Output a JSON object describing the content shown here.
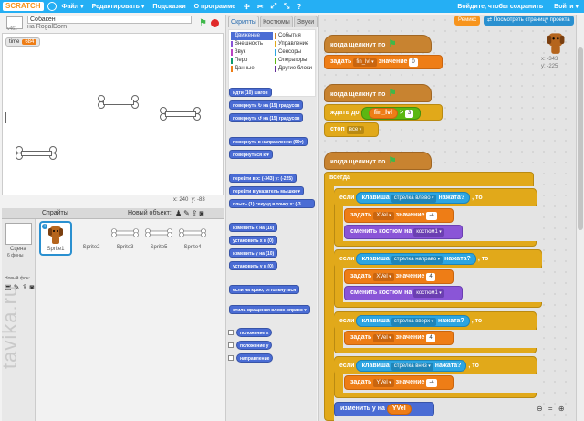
{
  "topbar": {
    "logo": "SCRATCH",
    "menu": [
      "Файл ▾",
      "Редактировать ▾",
      "Подсказки",
      "О программе"
    ],
    "right_save": "Войдите, чтобы сохранить",
    "right_login": "Войти ▾"
  },
  "project": {
    "title": "Собакен",
    "author": "на RogalDorn",
    "version": "v461"
  },
  "stage": {
    "monitor_label": "time",
    "monitor_value": "684",
    "coords_x": "x: 240",
    "coords_y": "y: -83"
  },
  "sprites_panel": {
    "label": "Спрайты",
    "new_object": "Новый объект:",
    "stage_label": "Сцена",
    "stage_sub": "6 фоны",
    "new_backdrop": "Новый фон:",
    "sprites": [
      "Sprite1",
      "Sprite2",
      "Sprite3",
      "Sprite5",
      "Sprite4"
    ]
  },
  "palette": {
    "tabs": [
      "Скрипты",
      "Костюмы",
      "Звуки"
    ],
    "categories_left": [
      "Движение",
      "Внешность",
      "Звук",
      "Перо",
      "Данные"
    ],
    "categories_right": [
      "События",
      "Управление",
      "Сенсоры",
      "Операторы",
      "Другие блоки"
    ],
    "blocks": [
      "идти (10) шагов",
      "повернуть ↻ на (15) градусов",
      "повернуть ↺ на (15) градусов",
      "повернуть в направлении (90▾)",
      "повернуться к ▾",
      "перейти в x: (-343) y: (-225)",
      "перейти в указатель мышки ▾",
      "плыть (1) секунд в точку x: (-3",
      "изменить х на (10)",
      "установить х в (0)",
      "изменить у на (10)",
      "установить у в (0)",
      "если на краю, оттолкнуться",
      "стиль вращения влево-вправо ▾",
      "положение х",
      "положение у",
      "направление"
    ]
  },
  "buttons": {
    "remix": "Ремикс",
    "see_project": "Посмотреть страницу проекта"
  },
  "sprite_info": {
    "x": "x: -343",
    "y": "y: -225"
  },
  "scripts": {
    "s1_hat": "когда щелкнут по",
    "s1_set": "задать",
    "s1_var": "fin_lvl",
    "s1_value": "значение",
    "s1_num": "0",
    "s2_hat": "когда щелкнут по",
    "s2_wait": "ждать до",
    "s2_var": "fin_lvl",
    "s2_op": ">",
    "s2_num": "3",
    "s2_stop": "стоп",
    "s2_stop_opt": "все",
    "s3_hat": "когда щелкнут по",
    "s3_forever": "всегда",
    "if": "если",
    "then": ", то",
    "key": "клавиша",
    "pressed": "нажата?",
    "set": "задать",
    "value": "значение",
    "costume_change": "сменить костюм на",
    "costume": "костюм1",
    "if1_key": "стрелка влево",
    "if1_var": "XVel",
    "if1_val": "-4",
    "if2_key": "стрелка направо",
    "if2_var": "XVel",
    "if2_val": "4",
    "if3_key": "стрелка вверх",
    "if3_var": "YVel",
    "if3_val": "4",
    "if4_key": "стрелка вниз",
    "if4_var": "YVel",
    "if4_val": "-4",
    "change_y": "изменить у на",
    "change_y_var": "YVel"
  },
  "watermark": "tavika.ru",
  "colors": {
    "topbar": "#25aff4",
    "events": "#c88330",
    "control": "#e1a91a",
    "data": "#ee7d16",
    "sensing": "#2ca5e2",
    "looks": "#8a55d7",
    "motion": "#4a6cd4",
    "operators": "#5cb712"
  },
  "zoom_controls": "⊖ = ⊕"
}
